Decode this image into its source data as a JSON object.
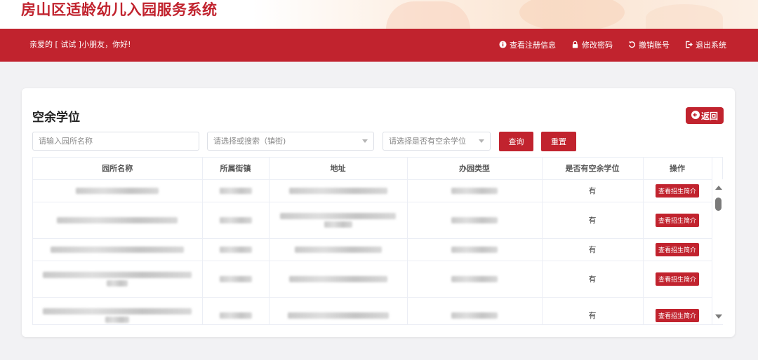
{
  "header": {
    "title": "房山区适龄幼儿入园服务系统"
  },
  "nav": {
    "greeting": "亲爱的 [ 试试 ]小朋友，你好!",
    "actions": [
      {
        "label": "查看注册信息",
        "icon": "info-icon"
      },
      {
        "label": "修改密码",
        "icon": "lock-icon"
      },
      {
        "label": "撤销账号",
        "icon": "undo-icon"
      },
      {
        "label": "退出系统",
        "icon": "logout-icon"
      }
    ]
  },
  "colors": {
    "accent": "#c1232e"
  },
  "page": {
    "title": "空余学位",
    "back_label": "返回",
    "filters": {
      "name_placeholder": "请输入园所名称",
      "street_placeholder": "请选择或搜索（镇街)",
      "vacancy_placeholder": "请选择是否有空余学位"
    },
    "query_label": "查询",
    "reset_label": "重置"
  },
  "table": {
    "columns": [
      "园所名称",
      "所属街镇",
      "地址",
      "办园类型",
      "是否有空余学位",
      "操作"
    ],
    "rows": [
      {
        "vacancy": "有",
        "action": "查看招生简介"
      },
      {
        "vacancy": "有",
        "action": "查看招生简介"
      },
      {
        "vacancy": "有",
        "action": "查看招生简介"
      },
      {
        "vacancy": "有",
        "action": "查看招生简介"
      },
      {
        "vacancy": "有",
        "action": "查看招生简介"
      }
    ]
  }
}
